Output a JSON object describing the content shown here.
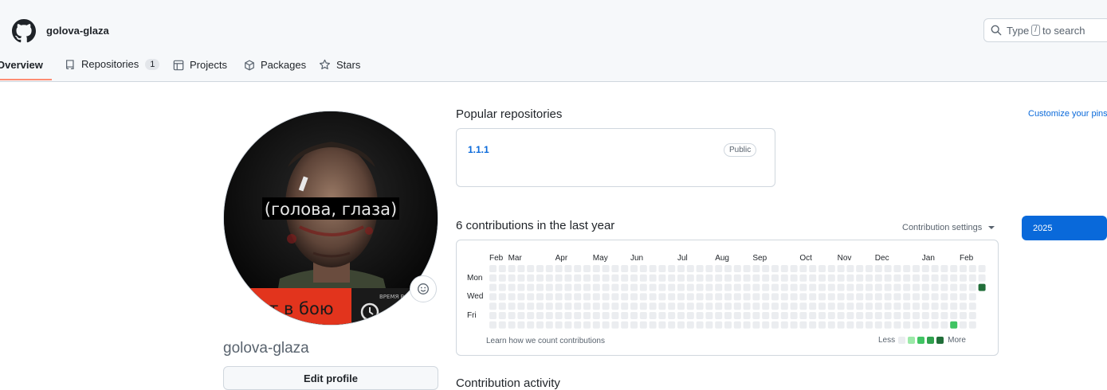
{
  "header": {
    "username": "golova-glaza",
    "search": {
      "prefix": "Type",
      "key": "/",
      "suffix": "to search"
    }
  },
  "nav": {
    "tabs": [
      {
        "label": "Overview",
        "active": true
      },
      {
        "label": "Repositories",
        "count": "1"
      },
      {
        "label": "Projects"
      },
      {
        "label": "Packages"
      },
      {
        "label": "Stars"
      }
    ]
  },
  "profile": {
    "avatar_caption": "(голова, глаза)",
    "avatar_banner": "ит в бою",
    "avatar_banner_small": "ВРЕМЯ Р",
    "name": "golova-glaza",
    "edit_label": "Edit profile"
  },
  "popular": {
    "title": "Popular repositories",
    "customize": "Customize your pins",
    "repos": [
      {
        "name": "1.1.1",
        "visibility": "Public"
      }
    ]
  },
  "contributions": {
    "title": "6 contributions in the last year",
    "settings_label": "Contribution settings",
    "year": "2025",
    "months": [
      "Feb",
      "Mar",
      "Apr",
      "May",
      "Jun",
      "Jul",
      "Aug",
      "Sep",
      "Oct",
      "Nov",
      "Dec",
      "Jan",
      "Feb"
    ],
    "days": [
      "Mon",
      "Wed",
      "Fri"
    ],
    "weeks": 53,
    "active_cells": [
      {
        "week": 52,
        "day": 2,
        "level": 4
      },
      {
        "week": 49,
        "day": 6,
        "level": 2
      }
    ],
    "learn_link": "Learn how we count contributions",
    "legend_less": "Less",
    "legend_more": "More",
    "colors": {
      "level0": "#ebedf0",
      "level1": "#9be9a8",
      "level2": "#40c463",
      "level3": "#30a14e",
      "level4": "#216e39"
    }
  },
  "activity": {
    "title": "Contribution activity"
  }
}
